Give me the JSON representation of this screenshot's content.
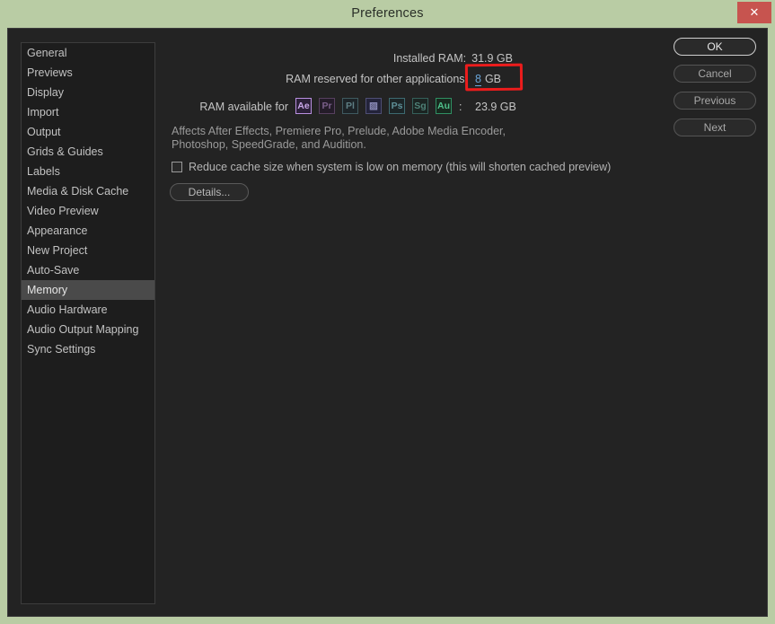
{
  "window": {
    "title": "Preferences",
    "close_label": "✕"
  },
  "sidebar": {
    "items": [
      {
        "label": "General",
        "selected": false
      },
      {
        "label": "Previews",
        "selected": false
      },
      {
        "label": "Display",
        "selected": false
      },
      {
        "label": "Import",
        "selected": false
      },
      {
        "label": "Output",
        "selected": false
      },
      {
        "label": "Grids & Guides",
        "selected": false
      },
      {
        "label": "Labels",
        "selected": false
      },
      {
        "label": "Media & Disk Cache",
        "selected": false
      },
      {
        "label": "Video Preview",
        "selected": false
      },
      {
        "label": "Appearance",
        "selected": false
      },
      {
        "label": "New Project",
        "selected": false
      },
      {
        "label": "Auto-Save",
        "selected": false
      },
      {
        "label": "Memory",
        "selected": true
      },
      {
        "label": "Audio Hardware",
        "selected": false
      },
      {
        "label": "Audio Output Mapping",
        "selected": false
      },
      {
        "label": "Sync Settings",
        "selected": false
      }
    ]
  },
  "memory_panel": {
    "installed_ram_label": "Installed RAM:",
    "installed_ram_value": "31.9 GB",
    "reserved_label": "RAM reserved for other applications:",
    "reserved_value": "8",
    "reserved_unit": "GB",
    "available_label": "RAM available for",
    "available_colon": ":",
    "available_value": "23.9 GB",
    "app_icons": [
      {
        "name": "after-effects-icon",
        "glyph": "Ae",
        "color": "#c8a6e8",
        "border": "#b98fe0",
        "bg": "#2b2038",
        "active": true
      },
      {
        "name": "premiere-pro-icon",
        "glyph": "Pr",
        "color": "#7a5f8a",
        "border": "#57405f",
        "bg": "#241c29",
        "active": false
      },
      {
        "name": "prelude-icon",
        "glyph": "Pl",
        "color": "#5f7f85",
        "border": "#3f5a60",
        "bg": "#1d2428",
        "active": false
      },
      {
        "name": "media-encoder-icon",
        "glyph": "▨",
        "color": "#8a8ab8",
        "border": "#4e4e74",
        "bg": "#23233a",
        "active": false
      },
      {
        "name": "photoshop-icon",
        "glyph": "Ps",
        "color": "#5f9098",
        "border": "#3d6a70",
        "bg": "#1c2527",
        "active": false
      },
      {
        "name": "speedgrade-icon",
        "glyph": "Sg",
        "color": "#4f8278",
        "border": "#35605a",
        "bg": "#1b2422",
        "active": false
      },
      {
        "name": "audition-icon",
        "glyph": "Au",
        "color": "#4fc08a",
        "border": "#2f8f62",
        "bg": "#18291f",
        "active": true
      }
    ],
    "affects_text": "Affects After Effects, Premiere Pro, Prelude, Adobe Media Encoder, Photoshop, SpeedGrade, and Audition.",
    "reduce_cache_label": "Reduce cache size when system is low on memory (this will shorten cached preview)",
    "reduce_cache_checked": false,
    "details_label": "Details..."
  },
  "actions": {
    "ok": "OK",
    "cancel": "Cancel",
    "previous": "Previous",
    "next": "Next"
  },
  "colors": {
    "titlebar_bg": "#b9cca4",
    "close_bg": "#c7544f",
    "dialog_bg": "#232323",
    "selected_item_bg": "#4a4a4a",
    "scrub_value": "#6aa5d8",
    "annotation": "#ec1c1c"
  }
}
